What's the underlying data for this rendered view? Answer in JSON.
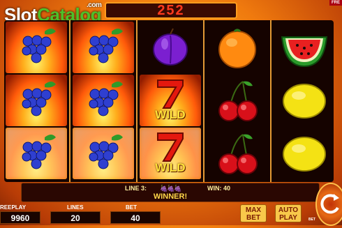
{
  "logo": {
    "part1": "Slot",
    "part2": "Catalog",
    "suffix": ".com"
  },
  "win_display": "252",
  "corner_tag": "FRE",
  "reels": [
    [
      "grapes-fire",
      "grapes-fire",
      "grapes-fire"
    ],
    [
      "grapes-fire",
      "grapes-fire",
      "grapes-fire"
    ],
    [
      "plum",
      "wild",
      "wild"
    ],
    [
      "orange",
      "cherry",
      "cherry"
    ],
    [
      "watermelon",
      "lemon",
      "lemon"
    ]
  ],
  "wild_label": "WILD",
  "status": {
    "line": "LINE 3:",
    "win": "WIN: 40",
    "message": "WINNER!"
  },
  "footer": {
    "freeplay_label": "REEPLAY",
    "freeplay_value": "9960",
    "lines_label": "LINES",
    "lines_value": "20",
    "bet_label": "BET",
    "bet_value": "40"
  },
  "buttons": {
    "maxbet_line1": "MAX",
    "maxbet_line2": "BET",
    "autoplay_line1": "AUTO",
    "autoplay_line2": "PLAY",
    "bet_mini": "BET"
  },
  "colors": {
    "accent": "#ff9c1e",
    "win_text": "#ff3a1e",
    "wild": "#ffe43a"
  }
}
